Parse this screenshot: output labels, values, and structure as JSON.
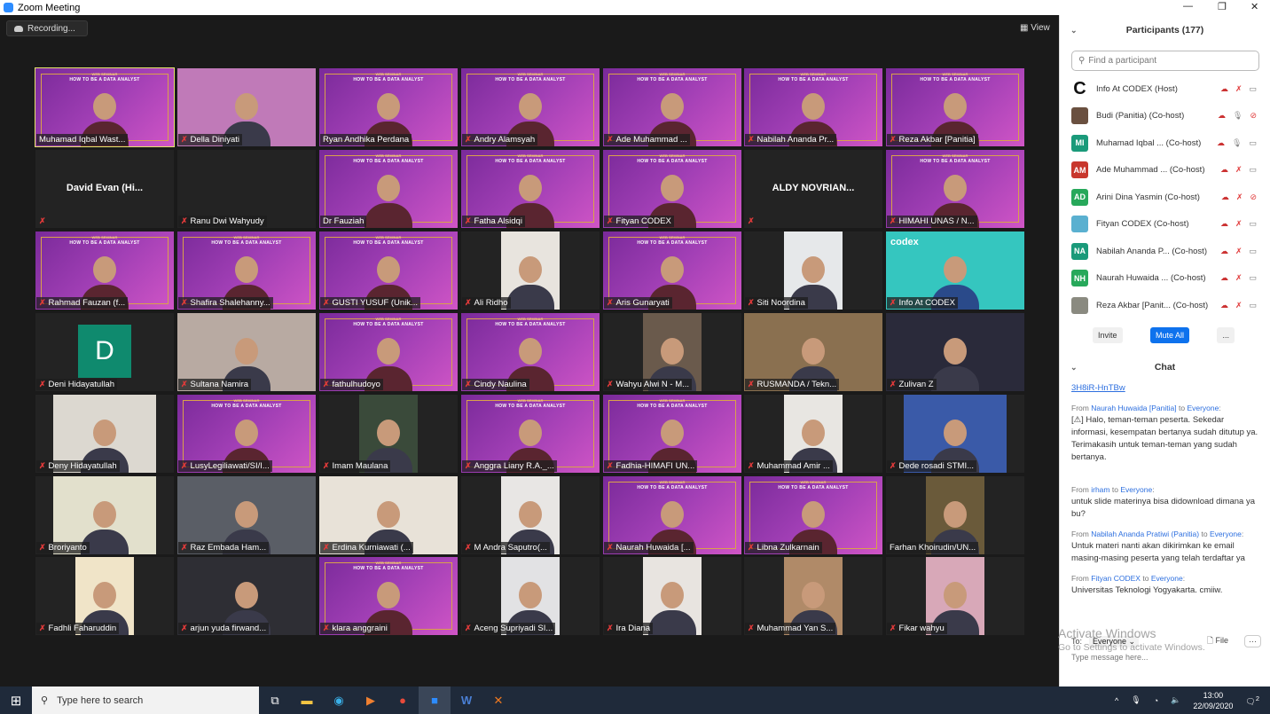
{
  "window": {
    "title": "Zoom Meeting",
    "controls": [
      "—",
      "❐",
      "✕"
    ]
  },
  "toolbar": {
    "recording": "Recording...",
    "view": "View"
  },
  "slide": {
    "line1": "WEB SEMINAR",
    "line2": "HOW TO BE A DATA ANALYST"
  },
  "tiles": [
    {
      "name": "Muhamad Iqbal Wast...",
      "muted": false,
      "type": "slide",
      "active": true
    },
    {
      "name": "Della Diniyati",
      "muted": true,
      "type": "full",
      "bg": "#c07ab8"
    },
    {
      "name": "Ryan Andhika Perdana",
      "muted": false,
      "type": "slide"
    },
    {
      "name": "Andry Alamsyah",
      "muted": true,
      "type": "slide"
    },
    {
      "name": "Ade Muhammad ...",
      "muted": true,
      "type": "slide"
    },
    {
      "name": "Nabilah Ananda Pr...",
      "muted": true,
      "type": "slide"
    },
    {
      "name": "Reza Akbar [Panitia]",
      "muted": true,
      "type": "slide"
    },
    {
      "name": "",
      "muted": true,
      "type": "name",
      "big": "David Evan  (Hi..."
    },
    {
      "name": "Ranu Dwi Wahyudy",
      "muted": true,
      "type": "blank"
    },
    {
      "name": "Dr Fauziah",
      "muted": false,
      "type": "slide"
    },
    {
      "name": "Fatha Alsidqi",
      "muted": true,
      "type": "slide"
    },
    {
      "name": "Fityan CODEX",
      "muted": true,
      "type": "slide"
    },
    {
      "name": "",
      "muted": true,
      "type": "name",
      "big": "ALDY NOVRIAN..."
    },
    {
      "name": "HIMAHI UNAS / N...",
      "muted": true,
      "type": "slide"
    },
    {
      "name": "Rahmad Fauzan (f...",
      "muted": true,
      "type": "slide"
    },
    {
      "name": "Shafira Shalehanny...",
      "muted": true,
      "type": "slide"
    },
    {
      "name": "GUSTI YUSUF (Unik...",
      "muted": true,
      "type": "slide"
    },
    {
      "name": "Ali Ridho",
      "muted": true,
      "type": "photo",
      "bg": "#e8e4de"
    },
    {
      "name": "Aris Gunaryati",
      "muted": true,
      "type": "slide"
    },
    {
      "name": "Siti Noordina",
      "muted": true,
      "type": "photo",
      "bg": "#e6e8ea"
    },
    {
      "name": "Info At CODEX",
      "muted": true,
      "type": "codex",
      "big": "codex"
    },
    {
      "name": "Deni Hidayatullah",
      "muted": true,
      "type": "avatar",
      "big": "D"
    },
    {
      "name": "Sultana Namira",
      "muted": true,
      "type": "full",
      "bg": "#b8aaa2"
    },
    {
      "name": "fathulhudoyo",
      "muted": true,
      "type": "slide"
    },
    {
      "name": "Cindy Naulina",
      "muted": true,
      "type": "slide"
    },
    {
      "name": "Wahyu Alwi N - M...",
      "muted": true,
      "type": "photo",
      "bg": "#6a5a4c"
    },
    {
      "name": "RUSMANDA / Tekn...",
      "muted": true,
      "type": "full",
      "bg": "#8a7050"
    },
    {
      "name": "Zulivan Z",
      "muted": true,
      "type": "full",
      "bg": "#2a2a3a"
    },
    {
      "name": "Deny Hidayatullah",
      "muted": true,
      "type": "photo",
      "bg": "#dcd8d0",
      "wide": true
    },
    {
      "name": "LusyLegiliawati/SI/I...",
      "muted": true,
      "type": "slide"
    },
    {
      "name": "Imam Maulana",
      "muted": true,
      "type": "photo",
      "bg": "#3a4a3a"
    },
    {
      "name": "Anggra Liany R.A._...",
      "muted": true,
      "type": "slide"
    },
    {
      "name": "Fadhia-HIMAFI UN...",
      "muted": true,
      "type": "slide"
    },
    {
      "name": "Muhammad Amir ...",
      "muted": true,
      "type": "photo",
      "bg": "#e8e6e2"
    },
    {
      "name": "Dede rosadi STMI...",
      "muted": true,
      "type": "photo",
      "bg": "#3a5aa8",
      "wide": true
    },
    {
      "name": "Broriyanto",
      "muted": true,
      "type": "photo",
      "bg": "#e2e0cc",
      "wide": true
    },
    {
      "name": "Raz Embada Ham...",
      "muted": true,
      "type": "full",
      "bg": "#5a5e66"
    },
    {
      "name": "Erdina Kurniawati (...",
      "muted": true,
      "type": "full",
      "bg": "#e8e2d8"
    },
    {
      "name": "M Andra Saputro(...",
      "muted": true,
      "type": "photo",
      "bg": "#e8e6e4"
    },
    {
      "name": "Naurah Huwaida [...",
      "muted": true,
      "type": "slide"
    },
    {
      "name": "Libna Zulkarnain",
      "muted": true,
      "type": "slide"
    },
    {
      "name": "Farhan Khoirudin/UN...",
      "muted": false,
      "type": "photo",
      "bg": "#6a5a3a"
    },
    {
      "name": "Fadhli Faharuddin",
      "muted": true,
      "type": "photo",
      "bg": "#f0e4c8"
    },
    {
      "name": "arjun yuda firwand...",
      "muted": true,
      "type": "full",
      "bg": "#2e2e34"
    },
    {
      "name": "klara anggraini",
      "muted": true,
      "type": "slide"
    },
    {
      "name": "Aceng Supriyadi SI...",
      "muted": true,
      "type": "photo",
      "bg": "#e2e2e4"
    },
    {
      "name": "Ira Diana",
      "muted": true,
      "type": "photo",
      "bg": "#e8e4e0"
    },
    {
      "name": "Muhammad  Yan S...",
      "muted": true,
      "type": "photo",
      "bg": "#b08a68"
    },
    {
      "name": "Fikar wahyu",
      "muted": true,
      "type": "photo",
      "bg": "#d8a8b8"
    }
  ],
  "participants": {
    "title": "Participants (177)",
    "search_placeholder": "Find a participant",
    "list": [
      {
        "name": "Info At CODEX (Host)",
        "initials": "C",
        "color": "#111111",
        "muted": true,
        "video_off": false
      },
      {
        "name": "Budi (Panitia) (Co-host)",
        "initials": "",
        "color": "#6a5040",
        "muted": false,
        "video_off": true
      },
      {
        "name": "Muhamad Iqbal ...  (Co-host)",
        "initials": "MI",
        "color": "#1a9a7a",
        "muted": false,
        "video_off": false
      },
      {
        "name": "Ade Muhammad ...  (Co-host)",
        "initials": "AM",
        "color": "#c8372d",
        "muted": true,
        "video_off": false
      },
      {
        "name": "Arini Dina Yasmin (Co-host)",
        "initials": "AD",
        "color": "#27a85a",
        "muted": true,
        "video_off": true
      },
      {
        "name": "Fityan CODEX (Co-host)",
        "initials": "",
        "color": "#5ab0d0",
        "muted": true,
        "video_off": false
      },
      {
        "name": "Nabilah Ananda P...  (Co-host)",
        "initials": "NA",
        "color": "#1a9a7a",
        "muted": true,
        "video_off": false
      },
      {
        "name": "Naurah Huwaida ...  (Co-host)",
        "initials": "NH",
        "color": "#27a85a",
        "muted": true,
        "video_off": false
      },
      {
        "name": "Reza Akbar [Panit...  (Co-host)",
        "initials": "",
        "color": "#8a8a80",
        "muted": true,
        "video_off": false
      }
    ],
    "invite": "Invite",
    "mute_all": "Mute All",
    "more": "..."
  },
  "chat": {
    "title": "Chat",
    "link_tail": "3H8iR-HnTBw",
    "messages": [
      {
        "from": "Naurah Huwaida [Panitia]",
        "to": "Everyone",
        "text": "[⚠] Halo, teman-teman peserta. Sekedar informasi, kesempatan bertanya sudah ditutup ya. Terimakasih untuk teman-teman yang sudah bertanya."
      },
      {
        "from": "irham",
        "to": "Everyone",
        "text": "untuk slide materinya bisa didownload dimana ya bu?"
      },
      {
        "from": "Nabilah Ananda Pratiwi (Panitia)",
        "to": "Everyone",
        "text": "Untuk materi nanti akan dikirimkan ke email masing-masing peserta yang telah terdaftar ya"
      },
      {
        "from": "Fityan CODEX",
        "to": "Everyone",
        "text": "Universitas Teknologi Yogyakarta. cmiiw."
      }
    ],
    "from_word": "From",
    "to_word": "to",
    "to_label": "To:",
    "recipient": "Everyone ⌄",
    "file": "File",
    "more": "···",
    "placeholder": "Type message here..."
  },
  "watermark": {
    "line1": "Activate Windows",
    "line2": "Go to Settings to activate Windows."
  },
  "taskbar": {
    "search": "Type here to search",
    "time": "13:00",
    "date": "22/09/2020",
    "notifications": "2"
  }
}
